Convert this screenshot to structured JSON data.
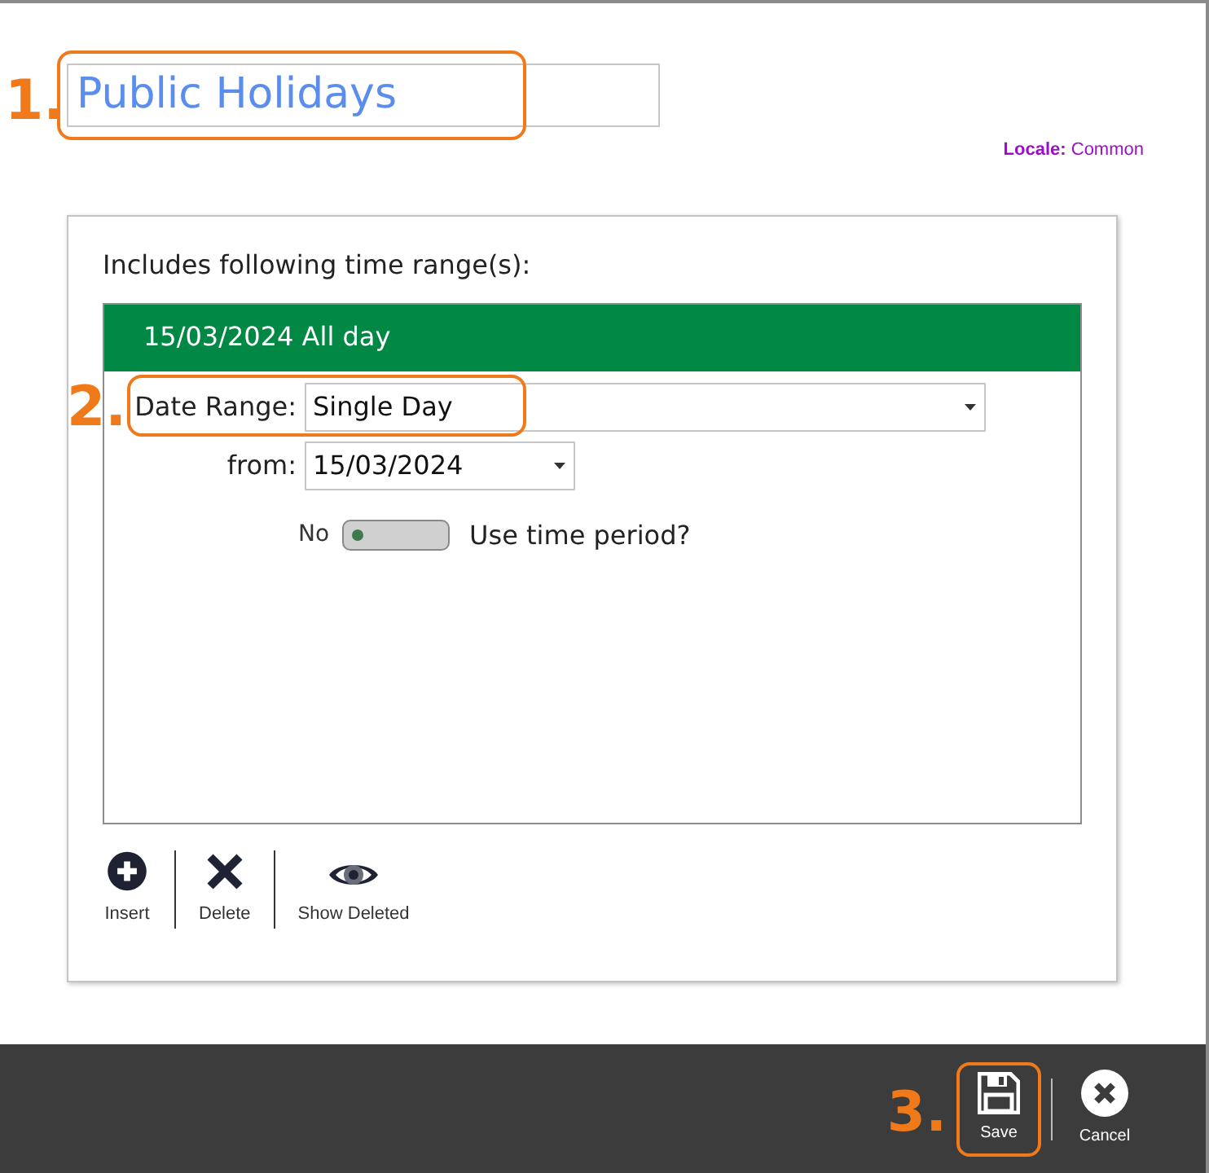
{
  "title_field": {
    "value": "Public Holidays"
  },
  "locale": {
    "label": "Locale:",
    "value": "Common"
  },
  "panel": {
    "heading": "Includes following time range(s):",
    "ranges": [
      {
        "label": "15/03/2024 All day",
        "selected": true
      }
    ],
    "date_range": {
      "label": "Date Range:",
      "value": "Single Day"
    },
    "from": {
      "label": "from:",
      "value": "15/03/2024"
    },
    "time_period": {
      "off_label": "No",
      "label": "Use time period?",
      "on": false
    },
    "toolbar": [
      {
        "label": "Insert",
        "kind": "insert"
      },
      {
        "label": "Delete",
        "kind": "delete"
      },
      {
        "label": "Show Deleted",
        "kind": "show_deleted"
      }
    ]
  },
  "footer": [
    {
      "label": "Save",
      "kind": "save"
    },
    {
      "label": "Cancel",
      "kind": "cancel"
    }
  ],
  "annotations": [
    "1.",
    "2.",
    "3."
  ]
}
